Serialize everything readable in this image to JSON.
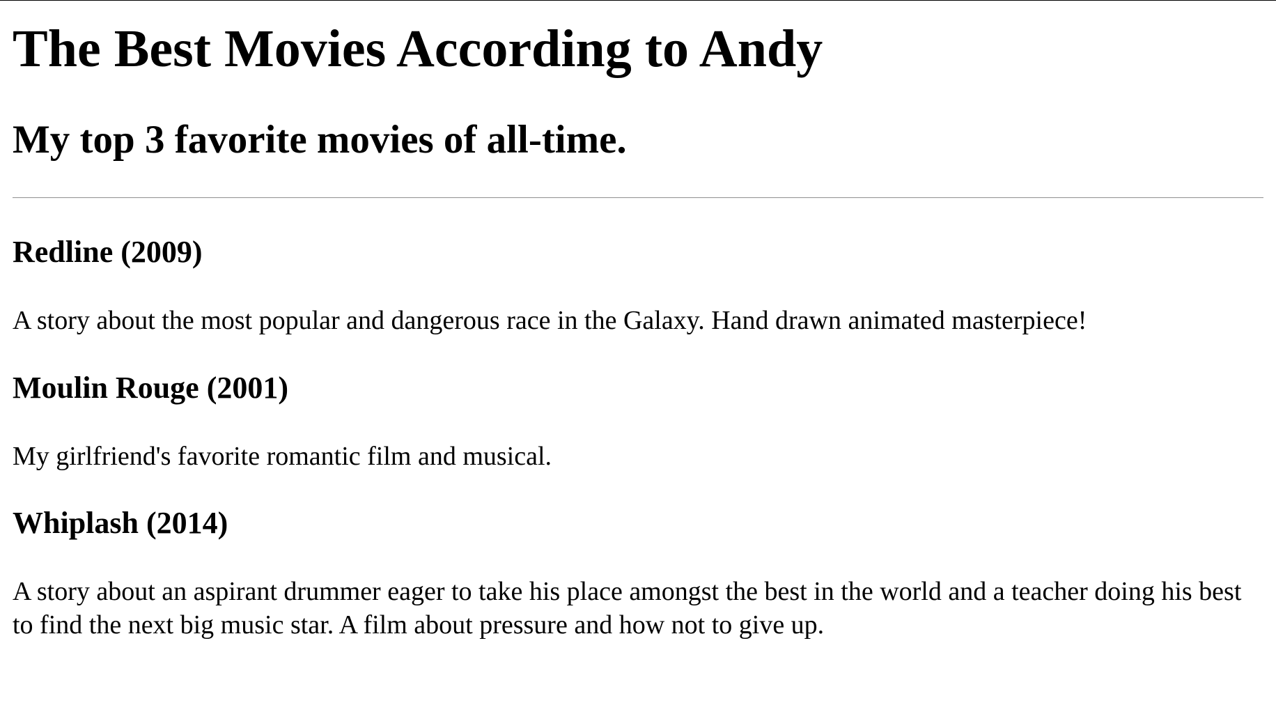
{
  "page": {
    "title": "The Best Movies According to Andy",
    "subtitle": "My top 3 favorite movies of all-time."
  },
  "movies": [
    {
      "title": "Redline (2009)",
      "description": "A story about the most popular and dangerous race in the Galaxy. Hand drawn animated masterpiece!"
    },
    {
      "title": "Moulin Rouge (2001)",
      "description": "My girlfriend's favorite romantic film and musical."
    },
    {
      "title": "Whiplash (2014)",
      "description": "A story about an aspirant drummer eager to take his place amongst the best in the world and a teacher doing his best to find the next big music star. A film about pressure and how not to give up."
    }
  ]
}
